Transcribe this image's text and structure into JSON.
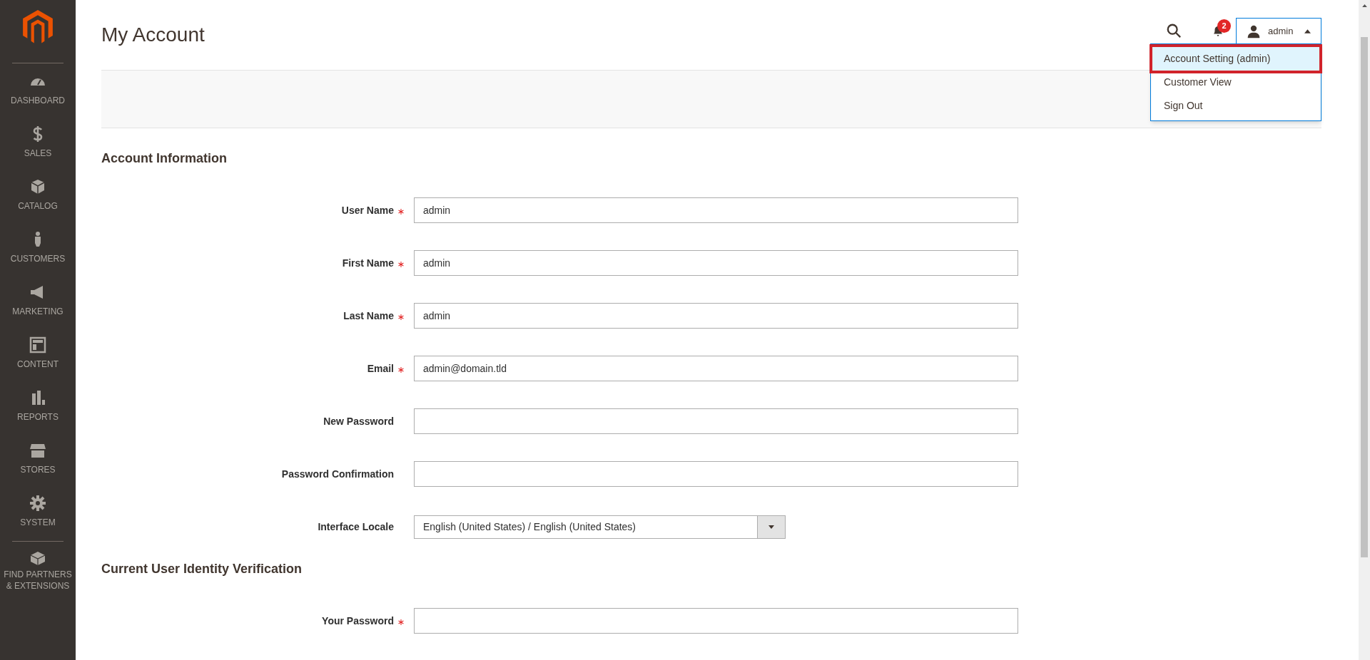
{
  "sidebar": {
    "items": [
      {
        "label": "DASHBOARD"
      },
      {
        "label": "SALES"
      },
      {
        "label": "CATALOG"
      },
      {
        "label": "CUSTOMERS"
      },
      {
        "label": "MARKETING"
      },
      {
        "label": "CONTENT"
      },
      {
        "label": "REPORTS"
      },
      {
        "label": "STORES"
      },
      {
        "label": "SYSTEM"
      }
    ],
    "extra": {
      "label": "FIND PARTNERS & EXTENSIONS"
    }
  },
  "page": {
    "title": "My Account"
  },
  "header": {
    "notifications": "2",
    "user": "admin",
    "menu_expanded": true,
    "menu": [
      {
        "label": "Account Setting (admin)",
        "selected": true
      },
      {
        "label": "Customer View",
        "selected": false
      },
      {
        "label": "Sign Out",
        "selected": false
      }
    ]
  },
  "sections": [
    {
      "title": "Account Information",
      "fields": [
        {
          "kind": "text",
          "label": "User Name",
          "required": true,
          "value": "admin"
        },
        {
          "kind": "text",
          "label": "First Name",
          "required": true,
          "value": "admin"
        },
        {
          "kind": "text",
          "label": "Last Name",
          "required": true,
          "value": "admin"
        },
        {
          "kind": "text",
          "label": "Email",
          "required": true,
          "value": "admin@domain.tld"
        },
        {
          "kind": "text",
          "label": "New Password",
          "required": false
        },
        {
          "kind": "text",
          "label": "Password Confirmation",
          "required": false
        },
        {
          "kind": "select",
          "label": "Interface Locale",
          "required": false,
          "value": "English (United States) / English (United States)"
        }
      ]
    },
    {
      "title": "Current User Identity Verification",
      "fields": [
        {
          "kind": "text",
          "label": "Your Password",
          "required": true
        }
      ]
    }
  ]
}
